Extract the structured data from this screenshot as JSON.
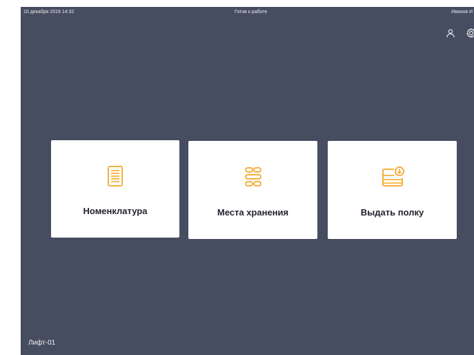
{
  "status_bar": {
    "datetime": "10 декабря 2019 14:32",
    "status": "Готов к работе",
    "user": "Иванов И"
  },
  "toolbar": {
    "user_icon": "user-icon",
    "settings_icon": "settings-icon"
  },
  "tiles": [
    {
      "label": "Номенклатура",
      "icon": "document-list-icon"
    },
    {
      "label": "Места хранения",
      "icon": "storage-shelves-icon"
    },
    {
      "label": "Выдать полку",
      "icon": "shelf-download-icon"
    }
  ],
  "footer": {
    "device": "Лифт-01"
  },
  "colors": {
    "background": "#474d60",
    "tile": "#ffffff",
    "accent": "#f5a623",
    "text": "#1f222b"
  }
}
